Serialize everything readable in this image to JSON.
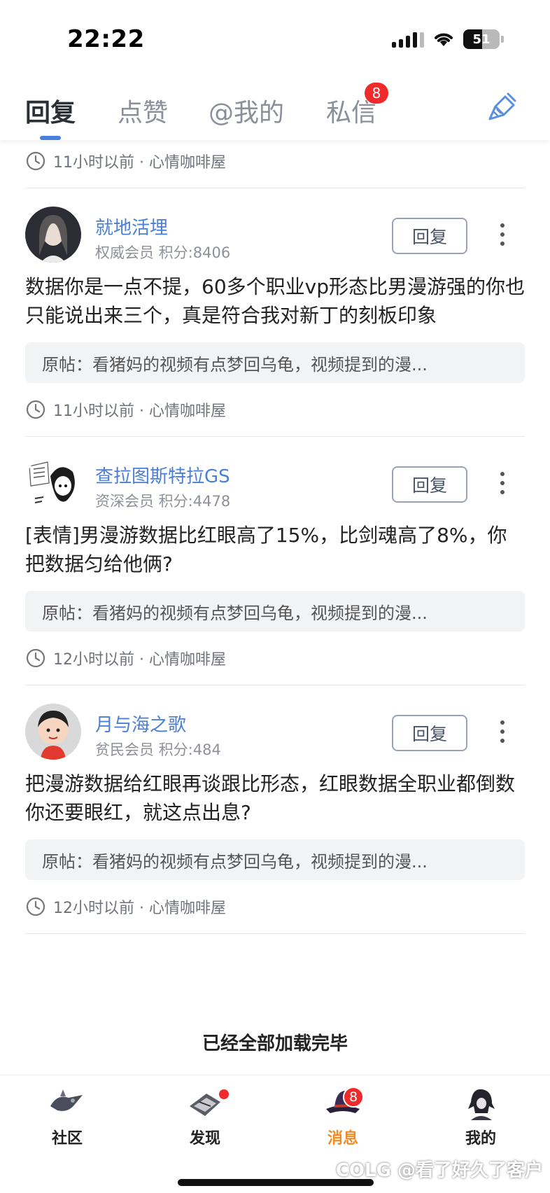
{
  "status_bar": {
    "time": "22:22",
    "battery": "51",
    "battery_level": 0.51
  },
  "tabs": [
    {
      "label": "回复",
      "active": true
    },
    {
      "label": "点赞",
      "active": false
    },
    {
      "label": "@我的",
      "active": false
    },
    {
      "label": "私信",
      "active": false,
      "badge": "8"
    }
  ],
  "top_meta": {
    "time": "11小时以前",
    "board": "· 心情咖啡屋"
  },
  "posts": [
    {
      "username": "就地活埋",
      "member": "权威会员 积分:8406",
      "reply_label": "回复",
      "text": "数据你是一点不提，60多个职业vp形态比男漫游强的你也只能说出来三个，真是符合我对新丁的刻板印象",
      "quote": "原帖：看猪妈的视频有点梦回乌龟，视频提到的漫...",
      "time": "11小时以前",
      "board": "· 心情咖啡屋"
    },
    {
      "username": "查拉图斯特拉GS",
      "member": "资深会员 积分:4478",
      "reply_label": "回复",
      "text": "[表情]男漫游数据比红眼高了15%，比剑魂高了8%，你把数据匀给他俩?",
      "quote": "原帖：看猪妈的视频有点梦回乌龟，视频提到的漫...",
      "time": "12小时以前",
      "board": "· 心情咖啡屋"
    },
    {
      "username": "月与海之歌",
      "member": "贫民会员 积分:484",
      "reply_label": "回复",
      "text": "把漫游数据给红眼再谈跟比形态，红眼数据全职业都倒数你还要眼红，就这点出息?",
      "quote": "原帖：看猪妈的视频有点梦回乌龟，视频提到的漫...",
      "time": "12小时以前",
      "board": "· 心情咖啡屋"
    }
  ],
  "footer_text": "已经全部加载完毕",
  "bottom_nav": [
    {
      "label": "社区",
      "icon": "community-icon"
    },
    {
      "label": "发现",
      "icon": "discover-icon",
      "dot": true
    },
    {
      "label": "消息",
      "icon": "messages-icon",
      "badge": "8",
      "active": true
    },
    {
      "label": "我的",
      "icon": "profile-icon"
    }
  ],
  "watermark": "COLG @看了好久了客户",
  "colors": {
    "accent": "#4a7fe0",
    "badge": "#f02a2a",
    "active_nav": "#f08a24",
    "username": "#4a7fd4"
  }
}
